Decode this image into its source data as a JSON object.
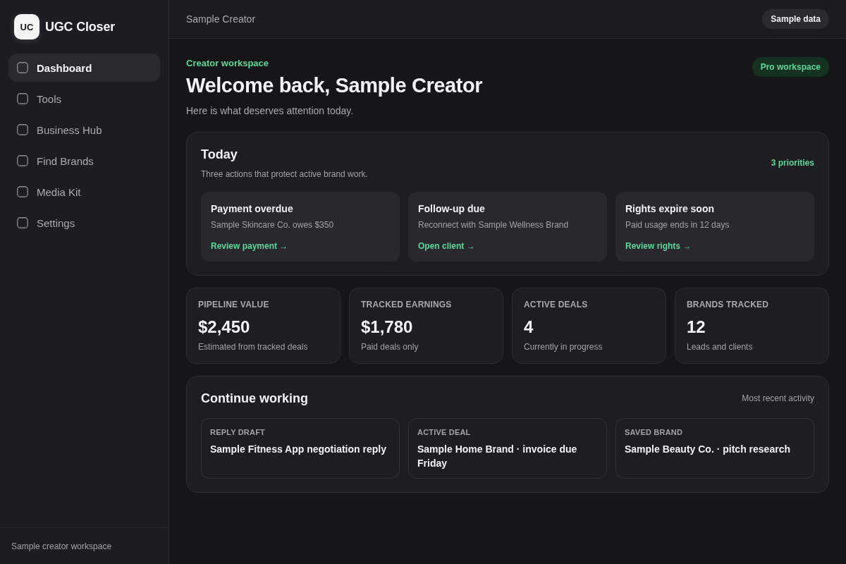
{
  "sidebar": {
    "logo": {
      "mark": "UC",
      "name": "UGC Closer"
    },
    "items": [
      {
        "label": "Dashboard",
        "selected": true
      },
      {
        "label": "Tools",
        "selected": false
      },
      {
        "label": "Business Hub",
        "selected": false
      },
      {
        "label": "Find Brands",
        "selected": false
      },
      {
        "label": "Media Kit",
        "selected": false
      },
      {
        "label": "Settings",
        "selected": false
      }
    ],
    "footer": "Sample creator workspace"
  },
  "top_bar": {
    "title": "Sample Creator",
    "badge": "Sample data"
  },
  "header": {
    "eyebrow": "Creator workspace",
    "title": "Welcome back, Sample Creator",
    "subtitle": "Here is what deserves attention today.",
    "badge": "Pro workspace"
  },
  "today": {
    "title": "Today",
    "subtitle": "Three actions that protect active brand work.",
    "count": "3 priorities",
    "cards": [
      {
        "title": "Payment overdue",
        "text": "Sample Skincare Co. owes $350",
        "link": "Review payment →"
      },
      {
        "title": "Follow-up due",
        "text": "Reconnect with Sample Wellness Brand",
        "link": "Open client →"
      },
      {
        "title": "Rights expire soon",
        "text": "Paid usage ends in 12 days",
        "link": "Review rights →"
      }
    ]
  },
  "stats": [
    {
      "label": "PIPELINE VALUE",
      "value": "$2,450",
      "note": "Estimated from tracked deals"
    },
    {
      "label": "TRACKED EARNINGS",
      "value": "$1,780",
      "note": "Paid deals only"
    },
    {
      "label": "ACTIVE DEALS",
      "value": "4",
      "note": "Currently in progress"
    },
    {
      "label": "BRANDS TRACKED",
      "value": "12",
      "note": "Leads and clients"
    }
  ],
  "continue_working": {
    "title": "Continue working",
    "meta": "Most recent activity",
    "items": [
      {
        "label": "REPLY DRAFT",
        "title": "Sample Fitness App negotiation reply"
      },
      {
        "label": "ACTIVE DEAL",
        "title": "Sample Home Brand · invoice due Friday"
      },
      {
        "label": "SAVED BRAND",
        "title": "Sample Beauty Co. · pitch research"
      }
    ]
  }
}
